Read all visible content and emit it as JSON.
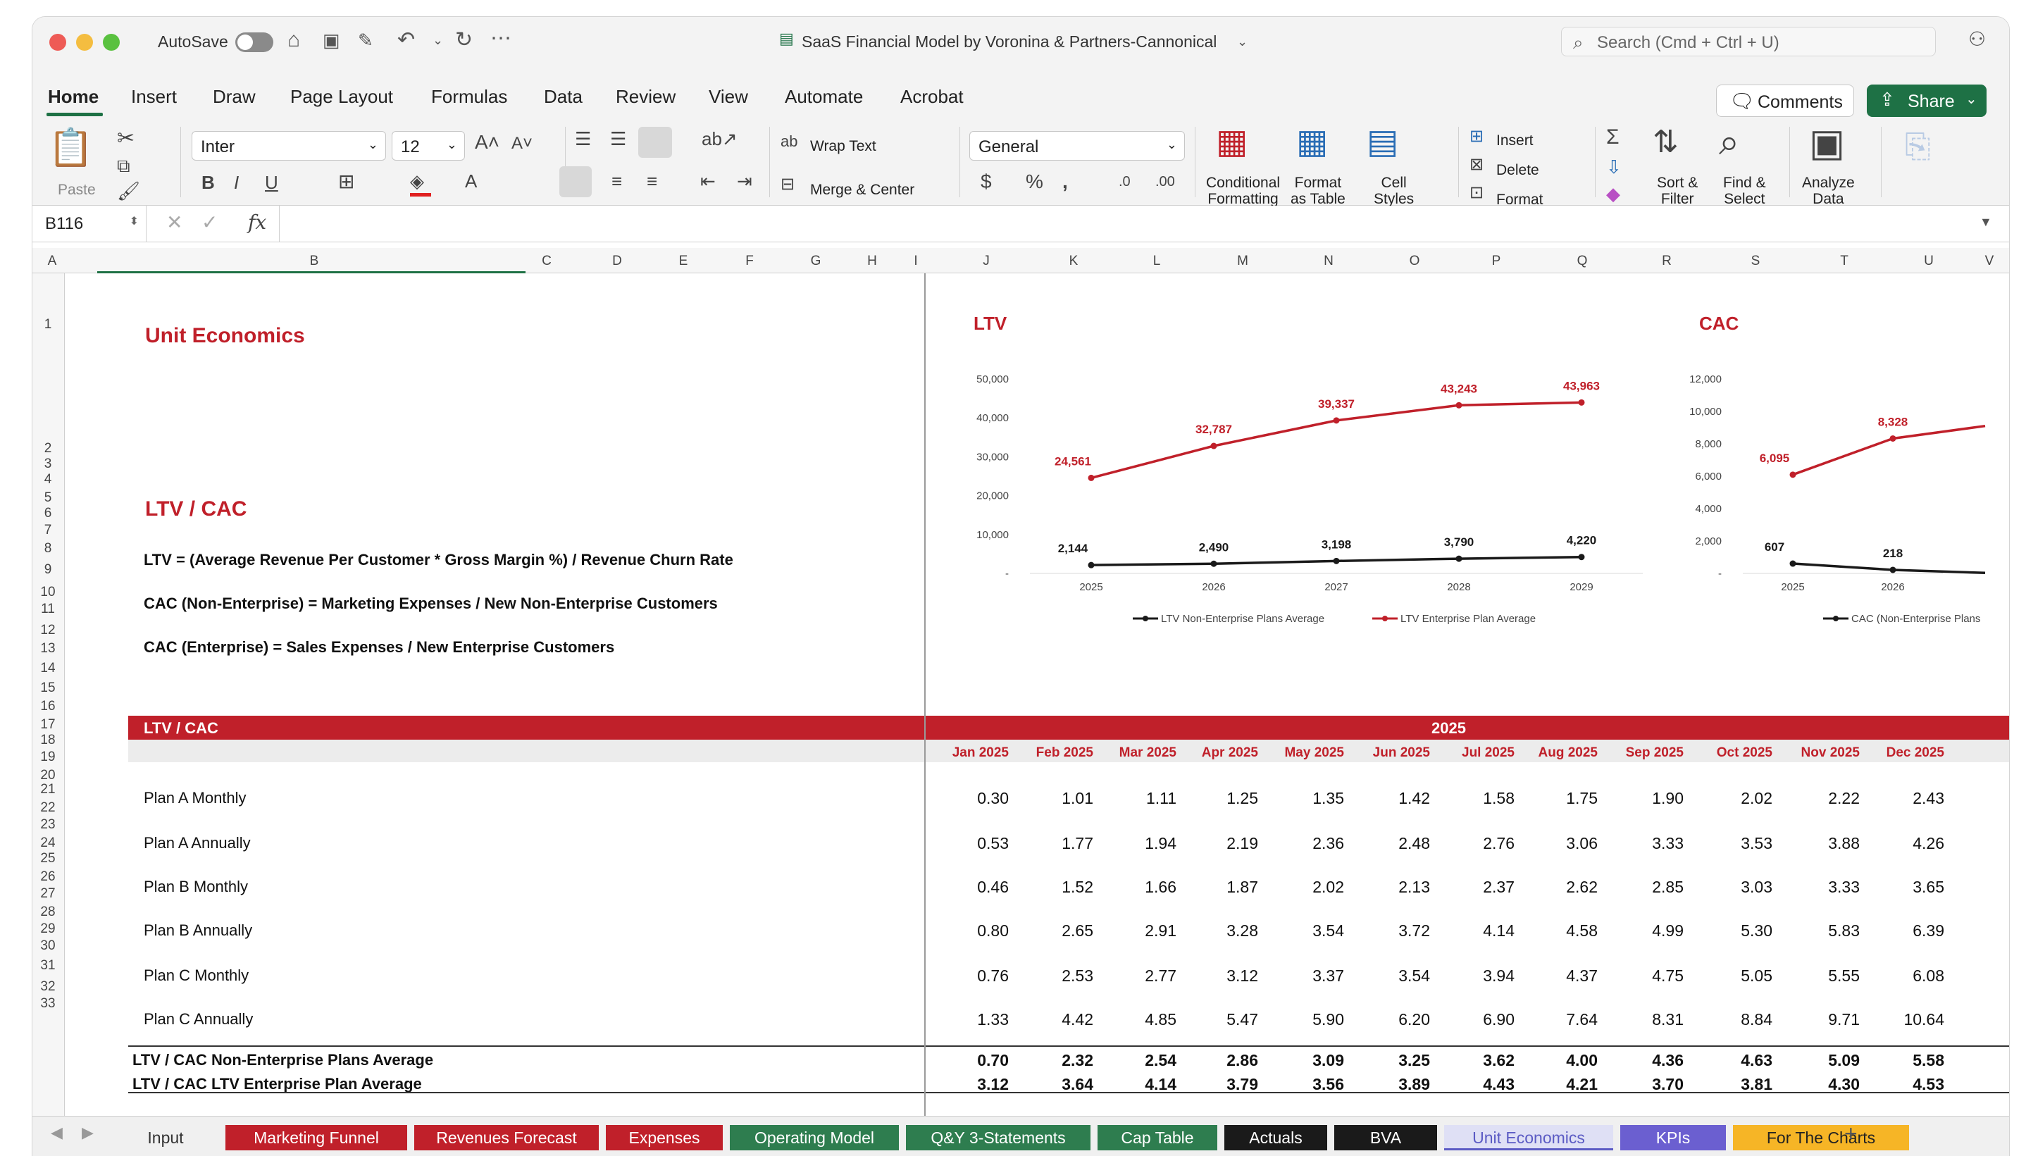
{
  "window": {
    "title": "SaaS Financial Model by Voronina & Partners-Cannonical",
    "autosave_label": "AutoSave",
    "search_placeholder": "Search (Cmd + Ctrl + U)",
    "traffic_colors": [
      "#ee5b56",
      "#f4bd40",
      "#59c13f"
    ]
  },
  "ribbon_tabs": [
    "Home",
    "Insert",
    "Draw",
    "Page Layout",
    "Formulas",
    "Data",
    "Review",
    "View",
    "Automate",
    "Acrobat"
  ],
  "buttons": {
    "comments": "Comments",
    "share": "Share"
  },
  "ribbon": {
    "paste": "Paste",
    "font": "Inter",
    "font_size": "12",
    "wrap_text": "Wrap Text",
    "merge_center": "Merge & Center",
    "number_format": "General",
    "conditional1": "Conditional",
    "conditional2": "Formatting",
    "format_table1": "Format",
    "format_table2": "as Table",
    "cell_styles1": "Cell",
    "cell_styles2": "Styles",
    "insert": "Insert",
    "delete": "Delete",
    "format": "Format",
    "sort1": "Sort &",
    "sort2": "Filter",
    "find1": "Find &",
    "find2": "Select",
    "analyze1": "Analyze",
    "analyze2": "Data"
  },
  "formula_bar": {
    "cell_ref": "B116",
    "fx": "fx",
    "formula": ""
  },
  "columns": [
    "A",
    "B",
    "C",
    "D",
    "E",
    "F",
    "G",
    "H",
    "I",
    "J",
    "K",
    "L",
    "M",
    "N",
    "O",
    "P",
    "Q",
    "R",
    "S",
    "T",
    "U",
    "V"
  ],
  "rows": [
    "1",
    "2",
    "3",
    "4",
    "5",
    "6",
    "7",
    "8",
    "9",
    "10",
    "11",
    "12",
    "13",
    "14",
    "15",
    "16",
    "17",
    "18",
    "19",
    "20",
    "21",
    "22",
    "23",
    "24",
    "25",
    "26",
    "27",
    "28",
    "29",
    "30",
    "31",
    "32",
    "33"
  ],
  "sheet": {
    "unit_economics": "Unit Economics",
    "ltv_cac_title": "LTV / CAC",
    "formula_ltv": "LTV = (Average Revenue Per Customer * Gross Margin %) / Revenue Churn Rate",
    "formula_cac_ne": "CAC (Non-Enterprise) = Marketing Expenses / New Non-Enterprise Customers",
    "formula_cac_e": "CAC (Enterprise) = Sales Expenses / New Enterprise Customers",
    "table_header": "LTV / CAC",
    "year": "2025",
    "months": [
      "Jan 2025",
      "Feb 2025",
      "Mar 2025",
      "Apr 2025",
      "May 2025",
      "Jun 2025",
      "Jul 2025",
      "Aug 2025",
      "Sep 2025",
      "Oct 2025",
      "Nov 2025",
      "Dec 2025"
    ],
    "plans": [
      {
        "name": "Plan A Monthly",
        "values": [
          "0.30",
          "1.01",
          "1.11",
          "1.25",
          "1.35",
          "1.42",
          "1.58",
          "1.75",
          "1.90",
          "2.02",
          "2.22",
          "2.43"
        ]
      },
      {
        "name": "Plan A Annually",
        "values": [
          "0.53",
          "1.77",
          "1.94",
          "2.19",
          "2.36",
          "2.48",
          "2.76",
          "3.06",
          "3.33",
          "3.53",
          "3.88",
          "4.26"
        ]
      },
      {
        "name": "Plan B Monthly",
        "values": [
          "0.46",
          "1.52",
          "1.66",
          "1.87",
          "2.02",
          "2.13",
          "2.37",
          "2.62",
          "2.85",
          "3.03",
          "3.33",
          "3.65"
        ]
      },
      {
        "name": "Plan B Annually",
        "values": [
          "0.80",
          "2.65",
          "2.91",
          "3.28",
          "3.54",
          "3.72",
          "4.14",
          "4.58",
          "4.99",
          "5.30",
          "5.83",
          "6.39"
        ]
      },
      {
        "name": "Plan C Monthly",
        "values": [
          "0.76",
          "2.53",
          "2.77",
          "3.12",
          "3.37",
          "3.54",
          "3.94",
          "4.37",
          "4.75",
          "5.05",
          "5.55",
          "6.08"
        ]
      },
      {
        "name": "Plan C Annually",
        "values": [
          "1.33",
          "4.42",
          "4.85",
          "5.47",
          "5.90",
          "6.20",
          "6.90",
          "7.64",
          "8.31",
          "8.84",
          "9.71",
          "10.64"
        ]
      }
    ],
    "avg_rows": [
      {
        "name": "LTV / CAC Non-Enterprise Plans Average",
        "values": [
          "0.70",
          "2.32",
          "2.54",
          "2.86",
          "3.09",
          "3.25",
          "3.62",
          "4.00",
          "4.36",
          "4.63",
          "5.09",
          "5.58"
        ]
      },
      {
        "name": "LTV / CAC LTV Enterprise Plan Average",
        "values": [
          "3.12",
          "3.64",
          "4.14",
          "3.79",
          "3.56",
          "3.89",
          "4.43",
          "4.21",
          "3.70",
          "3.81",
          "4.30",
          "4.53"
        ]
      }
    ]
  },
  "chart_data": [
    {
      "type": "line",
      "title": "LTV",
      "x": [
        "2025",
        "2026",
        "2027",
        "2028",
        "2029"
      ],
      "ylim": [
        0,
        50000
      ],
      "yticks": [
        "50,000",
        "40,000",
        "30,000",
        "20,000",
        "10,000",
        "-"
      ],
      "series": [
        {
          "name": "LTV Non-Enterprise Plans Average",
          "color": "#1a1a1a",
          "values": [
            2144,
            2490,
            3198,
            3790,
            4220
          ],
          "labels": [
            "2,144",
            "2,490",
            "3,198",
            "3,790",
            "4,220"
          ]
        },
        {
          "name": "LTV Enterprise Plan Average",
          "color": "#c0202a",
          "values": [
            24561,
            32787,
            39337,
            43243,
            43963
          ],
          "labels": [
            "24,561",
            "32,787",
            "39,337",
            "43,243",
            "43,963"
          ]
        }
      ],
      "legend": "bottom"
    },
    {
      "type": "line",
      "title": "CAC",
      "x": [
        "2025",
        "2026"
      ],
      "ylim": [
        0,
        12000
      ],
      "yticks": [
        "12,000",
        "10,000",
        "8,000",
        "6,000",
        "4,000",
        "2,000",
        "-"
      ],
      "series": [
        {
          "name": "CAC (Non-Enterprise Plans",
          "color": "#1a1a1a",
          "values": [
            607,
            218
          ],
          "labels": [
            "607",
            "218"
          ]
        },
        {
          "name": "",
          "color": "#c0202a",
          "values": [
            6095,
            8328
          ],
          "labels": [
            "6,095",
            "8,328"
          ]
        }
      ],
      "legend": "bottom"
    }
  ],
  "sheet_tabs": [
    {
      "name": "Input",
      "color": "#f0f0f0",
      "text": "#333"
    },
    {
      "name": "Marketing Funnel",
      "color": "#c0202a",
      "text": "#fff"
    },
    {
      "name": "Revenues Forecast",
      "color": "#c0202a",
      "text": "#fff"
    },
    {
      "name": "Expenses",
      "color": "#c0202a",
      "text": "#fff"
    },
    {
      "name": "Operating Model",
      "color": "#2e7d4f",
      "text": "#fff"
    },
    {
      "name": "Q&Y 3-Statements",
      "color": "#2e7d4f",
      "text": "#fff"
    },
    {
      "name": "Cap Table",
      "color": "#2e7d4f",
      "text": "#fff"
    },
    {
      "name": "Actuals",
      "color": "#1a1a1a",
      "text": "#fff"
    },
    {
      "name": "BVA",
      "color": "#1a1a1a",
      "text": "#fff"
    },
    {
      "name": "Unit Economics",
      "color": "#dfe0f5",
      "text": "#5b5bc4"
    },
    {
      "name": "KPIs",
      "color": "#6b5fd0",
      "text": "#fff"
    },
    {
      "name": "For The Charts",
      "color": "#f6b526",
      "text": "#222"
    }
  ]
}
